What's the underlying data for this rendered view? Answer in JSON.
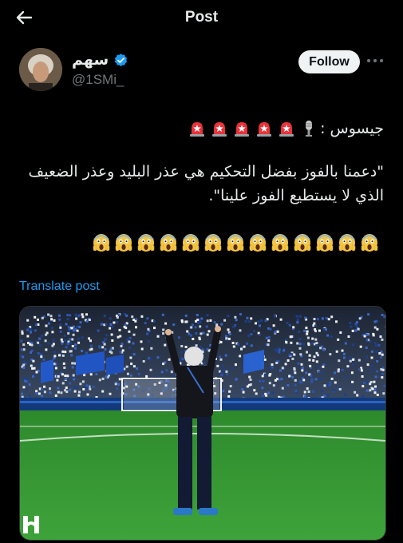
{
  "header": {
    "title": "Post"
  },
  "author": {
    "name": "سهم",
    "handle": "@1SMi_",
    "verified": true
  },
  "follow_label": "Follow",
  "post": {
    "line1": "جيسوس :",
    "line2": "\"دعمنا بالفوز بفضل التحكيم هي عذر البليد وعذر الضعيف الذي لا يستطيع الفوز علينا\".",
    "siren_count": 5,
    "scream_count": 13
  },
  "translate_label": "Translate post",
  "colors": {
    "accent": "#1d9bf0",
    "pitch": "#2f8f2f",
    "crowd_blue": "#1a3f8f"
  },
  "icons": [
    "back-arrow-icon",
    "verified-badge-icon",
    "more-icon",
    "microphone-icon",
    "siren-icon",
    "scream-face-icon",
    "alhilal-logo-icon"
  ]
}
